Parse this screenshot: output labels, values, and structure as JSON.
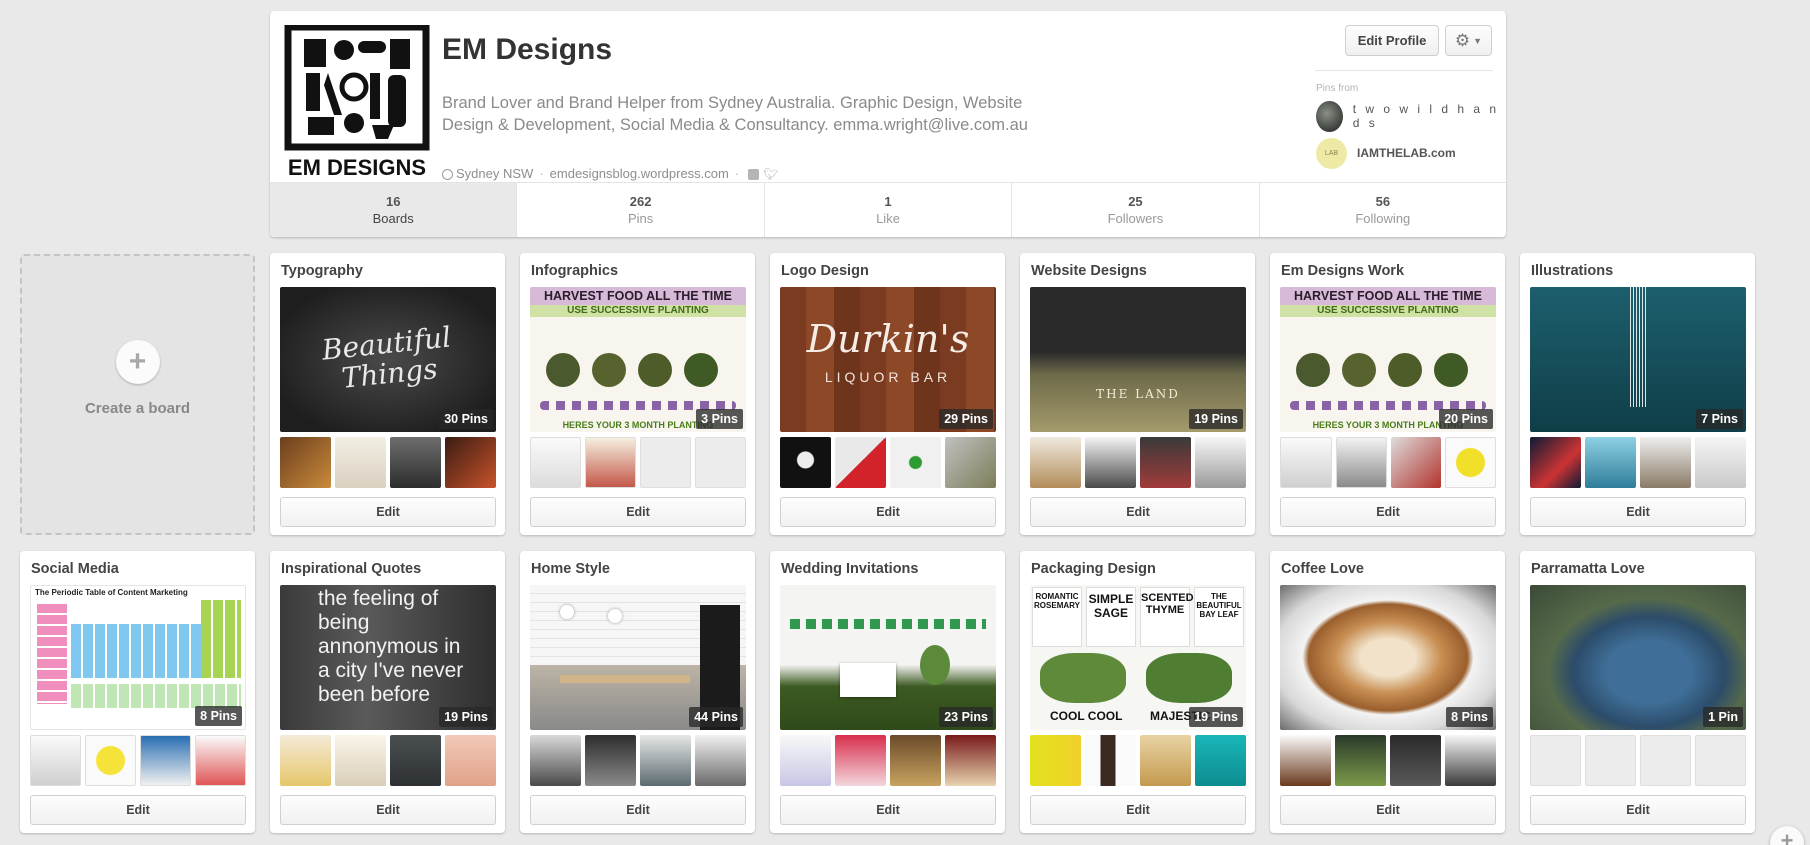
{
  "profile": {
    "name": "EM Designs",
    "about": "Brand Lover and Brand Helper from Sydney Australia. Graphic Design, Website Design & Development, Social Media & Consultancy. emma.wright@live.com.au",
    "location": "Sydney NSW",
    "website": "emdesignsblog.wordpress.com",
    "logo_text": "EM DESIGNS",
    "edit_label": "Edit Profile",
    "settings_icon": "gear-icon"
  },
  "pins_from": {
    "label": "Pins from",
    "sources": [
      {
        "name": "t w o w i l d h a n d s"
      },
      {
        "name": "IAMTHELAB.com",
        "badge": "LAB"
      }
    ]
  },
  "stats": [
    {
      "num": "16",
      "label": "Boards"
    },
    {
      "num": "262",
      "label": "Pins"
    },
    {
      "num": "1",
      "label": "Like"
    },
    {
      "num": "25",
      "label": "Followers"
    },
    {
      "num": "56",
      "label": "Following"
    }
  ],
  "create_board": {
    "label": "Create a board"
  },
  "boards": [
    {
      "title": "Typography",
      "count": "30 Pins",
      "edit": "Edit"
    },
    {
      "title": "Infographics",
      "count": "3 Pins",
      "edit": "Edit"
    },
    {
      "title": "Logo Design",
      "count": "29 Pins",
      "edit": "Edit"
    },
    {
      "title": "Website Designs",
      "count": "19 Pins",
      "edit": "Edit"
    },
    {
      "title": "Em Designs Work",
      "count": "20 Pins",
      "edit": "Edit"
    },
    {
      "title": "Illustrations",
      "count": "7 Pins",
      "edit": "Edit"
    },
    {
      "title": "Social Media",
      "count": "8 Pins",
      "edit": "Edit"
    },
    {
      "title": "Inspirational Quotes",
      "count": "19 Pins",
      "edit": "Edit"
    },
    {
      "title": "Home Style",
      "count": "44 Pins",
      "edit": "Edit"
    },
    {
      "title": "Wedding Invitations",
      "count": "23 Pins",
      "edit": "Edit"
    },
    {
      "title": "Packaging Design",
      "count": "19 Pins",
      "edit": "Edit"
    },
    {
      "title": "Coffee Love",
      "count": "8 Pins",
      "edit": "Edit"
    },
    {
      "title": "Parramatta Love",
      "count": "1 Pin",
      "edit": "Edit"
    }
  ],
  "cover_text": {
    "typography": "Beautiful Things",
    "infographic_banner": "HARVEST FOOD ALL THE TIME",
    "infographic_sub": "USE SUCCESSIVE PLANTING",
    "infographic_foot": "HERES YOUR 3 MONTH PLANTING",
    "logo": "Durkin's",
    "logo_sub": "LIQUOR BAR",
    "website": "THE LAND",
    "periodic": "The Periodic Table of Content Marketing",
    "quote": "the feeling of being annonymous in a city I've never been before",
    "packaging": [
      "ROMANTIC ROSEMARY",
      "SIMPLE SAGE",
      "SCENTED THYME",
      "THE BEAUTIFUL BAY LEAF",
      "COOL COOL",
      "MAJESTIC"
    ]
  }
}
